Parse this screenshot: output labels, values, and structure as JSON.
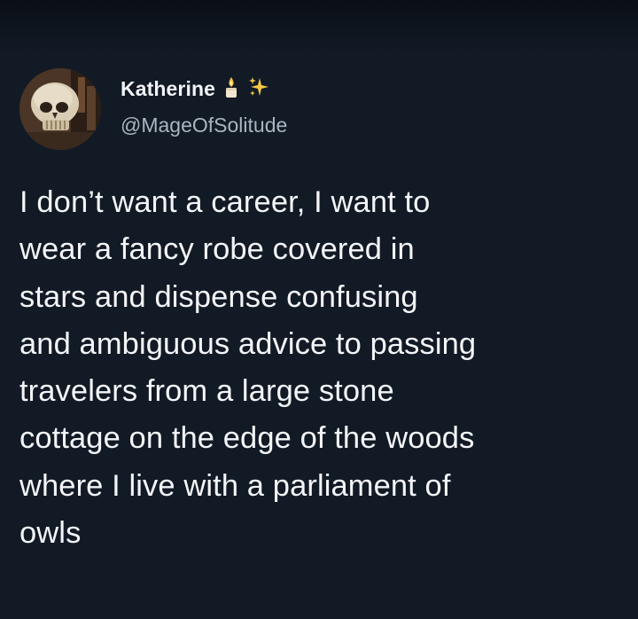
{
  "tweet": {
    "display_name": "Katherine",
    "handle": "@MageOfSolitude",
    "name_emojis": [
      "candle-icon",
      "sparkles-icon"
    ],
    "text_lines": [
      "I don’t want a career, I want to",
      "wear a fancy robe covered in",
      "stars and dispense confusing",
      "and ambiguous advice to passing",
      "travelers from a large stone",
      "cottage on the edge of the woods",
      "where I live with a parliament of",
      "owls"
    ]
  },
  "colors": {
    "background": "#121a25",
    "primary_text": "#f3f5f8",
    "secondary_text": "#aab4c0"
  }
}
